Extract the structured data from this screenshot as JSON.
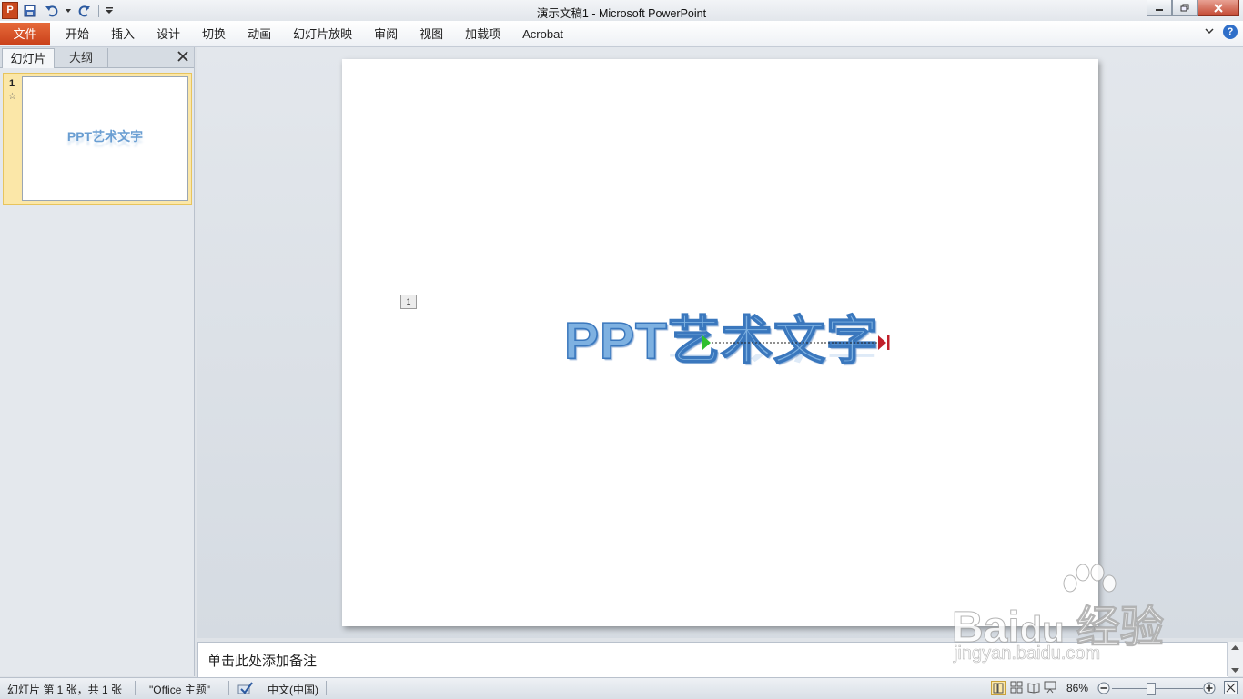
{
  "titlebar": {
    "app_icon_letter": "P",
    "title": "演示文稿1  -  Microsoft PowerPoint",
    "icons": [
      "save-icon",
      "undo-icon",
      "redo-icon",
      "customize-icon"
    ]
  },
  "ribbon": {
    "file_label": "文件",
    "tabs": [
      "开始",
      "插入",
      "设计",
      "切换",
      "动画",
      "幻灯片放映",
      "审阅",
      "视图",
      "加载项",
      "Acrobat"
    ],
    "help_label": "?"
  },
  "left_pane": {
    "tab_slides": "幻灯片",
    "tab_outline": "大纲",
    "slide_number": "1",
    "slide_anim_marker": "☆",
    "thumb_text": "PPT艺术文字"
  },
  "slide": {
    "anim_order": "1",
    "art_text": "PPT艺术文字"
  },
  "notes": {
    "placeholder": "单击此处添加备注"
  },
  "statusbar": {
    "slide_info": "幻灯片 第 1 张，共 1 张",
    "theme": "\"Office 主题\"",
    "language": "中文(中国)",
    "zoom": "86%"
  },
  "watermark": {
    "url": "jingyan.baidu.com"
  },
  "colors": {
    "file_tab": "#d3542a",
    "art_fill": "#7eb1e1",
    "art_stroke": "#3a77bd",
    "path_start": "#2fbf2f",
    "path_end": "#c0202a"
  }
}
